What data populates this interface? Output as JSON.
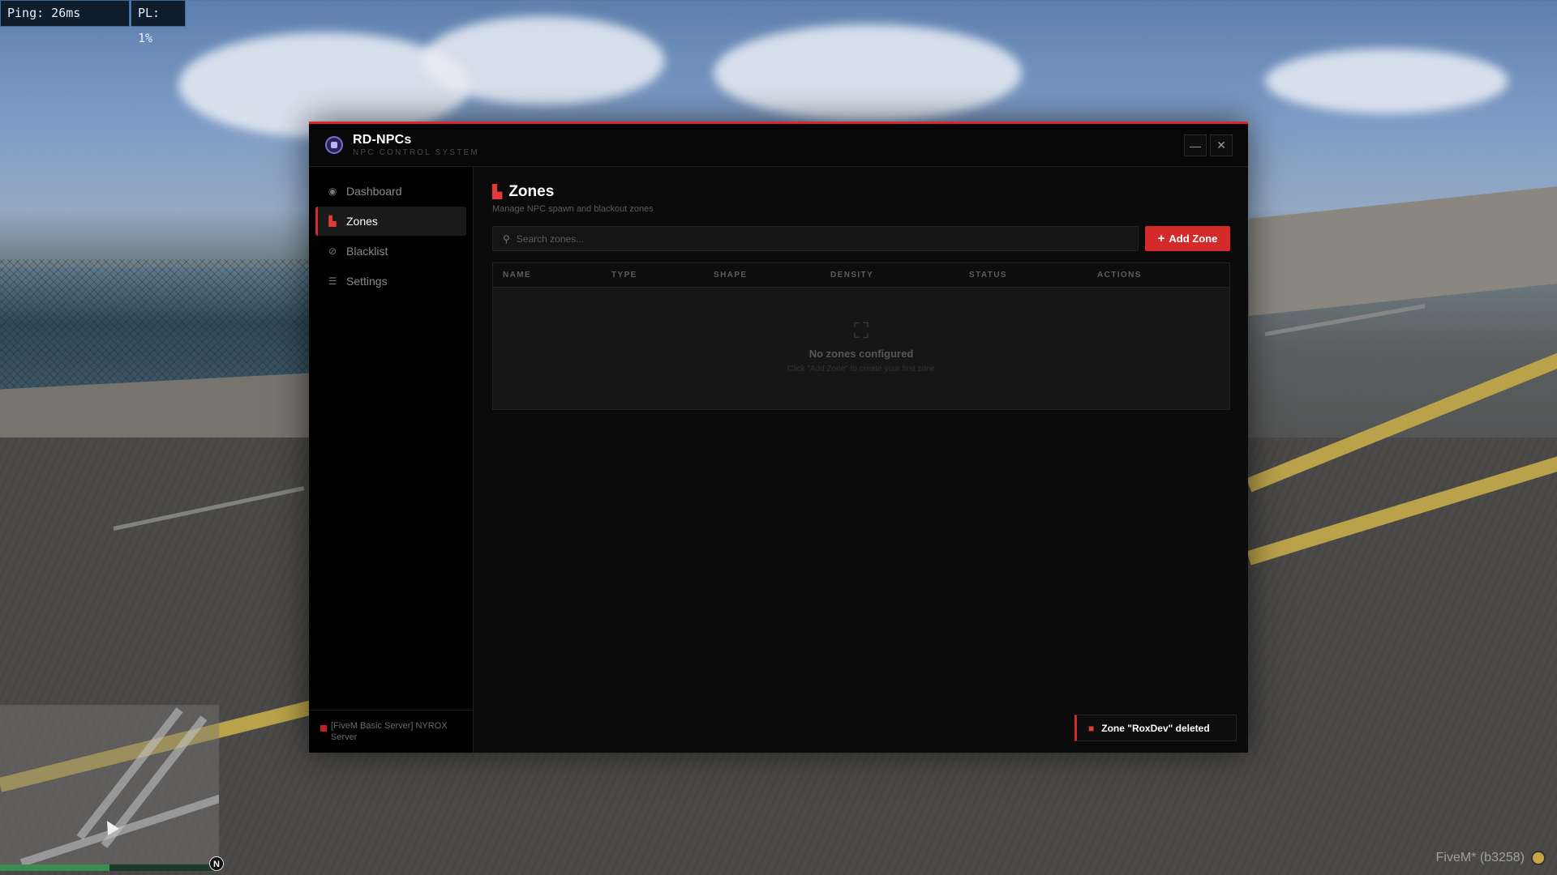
{
  "hud": {
    "ping": "Ping: 26ms",
    "packet_loss": "PL: 1%",
    "watermark": "FiveM* (b3258)",
    "compass": "N",
    "health_level": 0.5
  },
  "app": {
    "title": "RD-NPCs",
    "subtitle": "NPC CONTROL SYSTEM",
    "minimize_label": "—",
    "close_label": "✕",
    "accent_color": "#d42a2a"
  },
  "sidebar": {
    "items": [
      {
        "label": "Dashboard",
        "icon": "dashboard-icon",
        "glyph": "◉"
      },
      {
        "label": "Zones",
        "icon": "map-icon",
        "glyph": "▙"
      },
      {
        "label": "Blacklist",
        "icon": "ban-icon",
        "glyph": "⊘"
      },
      {
        "label": "Settings",
        "icon": "sliders-icon",
        "glyph": "☰"
      }
    ],
    "active_index": 1,
    "server_name": "[FiveM Basic Server] NYROX Server"
  },
  "page": {
    "title": "Zones",
    "description": "Manage NPC spawn and blackout zones",
    "search_placeholder": "Search zones...",
    "add_button": "Add Zone"
  },
  "table": {
    "columns": [
      "NAME",
      "TYPE",
      "SHAPE",
      "DENSITY",
      "STATUS",
      "ACTIONS"
    ],
    "rows": [],
    "empty_title": "No zones configured",
    "empty_subtitle": "Click \"Add Zone\" to create your first zone"
  },
  "toast": {
    "message": "Zone \"RoxDev\" deleted"
  }
}
